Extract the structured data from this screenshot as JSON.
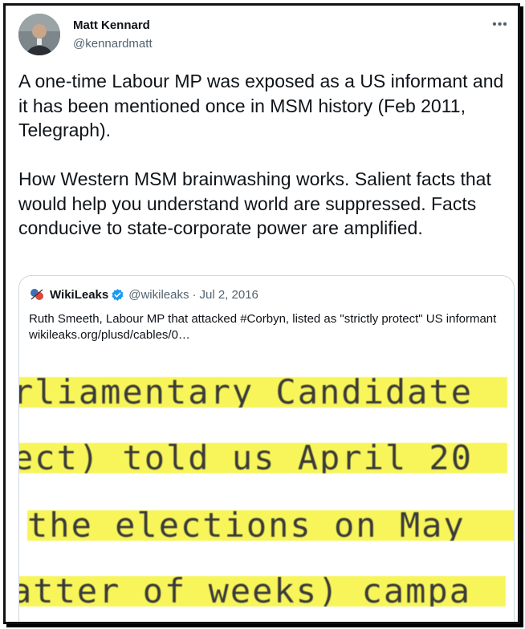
{
  "tweet": {
    "author_name": "Matt Kennard",
    "author_handle": "@kennardmatt",
    "more_icon": "more-horizontal-icon",
    "paragraphs": [
      "A one-time Labour MP was exposed as a US informant and it has been mentioned once in MSM history (Feb 2011, Telegraph).",
      "How Western MSM brainwashing works. Salient facts that would help you understand world are suppressed. Facts conducive to state-corporate power are amplified."
    ]
  },
  "quoted_tweet": {
    "author_name": "WikiLeaks",
    "verified": true,
    "author_handle": "@wikileaks",
    "separator": "·",
    "date": "Jul 2, 2016",
    "text": "Ruth Smeeth, Labour MP that attacked #Corbyn, listed as \"strictly protect\" US informant wikileaks.org/plusd/cables/0…",
    "image_lines": [
      "rliamentary Candidate",
      "ect) told us April 20",
      "the elections on May",
      "atter of weeks) campa"
    ]
  },
  "colors": {
    "text": "#0f1419",
    "secondary": "#536471",
    "verified": "#1d9bf0",
    "highlight": "#f7f55a",
    "border": "#cfd9de"
  }
}
